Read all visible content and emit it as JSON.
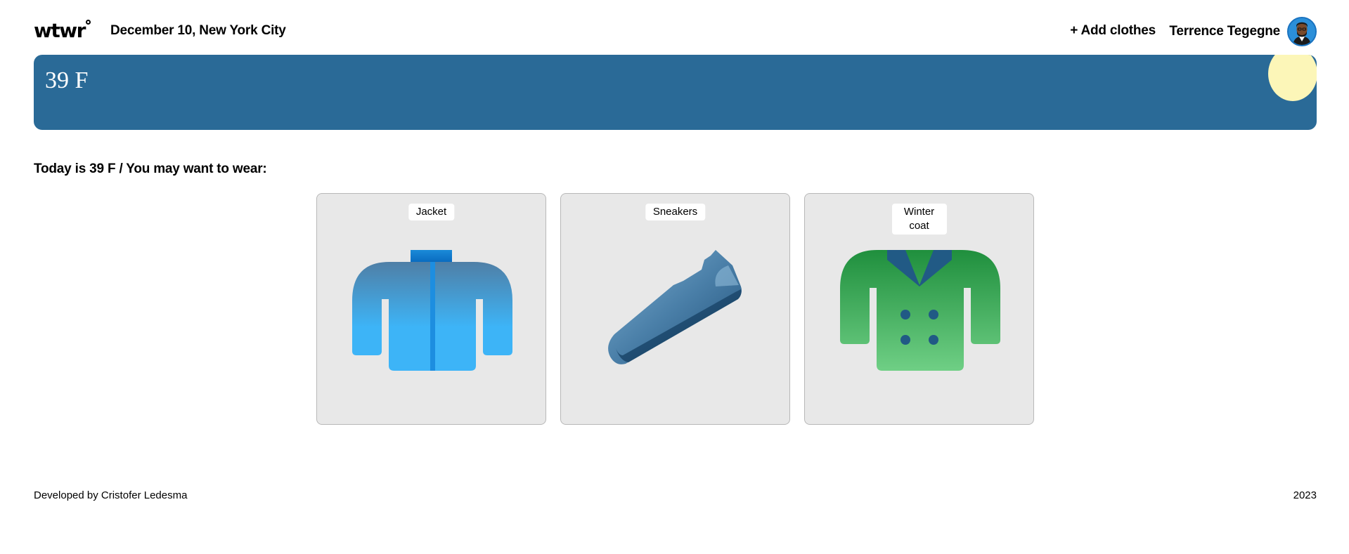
{
  "header": {
    "logo": "wtwr",
    "date_location": "December 10, New York City",
    "add_clothes_label": "+ Add clothes",
    "username": "Terrence Tegegne"
  },
  "weather": {
    "temperature": "39 F",
    "condition_icon": "sun-icon"
  },
  "main": {
    "recommendation": "Today is 39 F / You may want to wear:",
    "items": [
      {
        "name": "Jacket",
        "icon": "jacket-icon",
        "color": "#3db4f7"
      },
      {
        "name": "Sneakers",
        "icon": "sneaker-icon",
        "color": "#3d6e94"
      },
      {
        "name": "Winter coat",
        "icon": "winter-coat-icon",
        "color": "#2a9a45"
      }
    ]
  },
  "footer": {
    "credit": "Developed by Cristofer Ledesma",
    "year": "2023"
  },
  "colors": {
    "weather_bg": "#2a6a97",
    "sun": "#fcf6b8",
    "card_bg": "#e8e8e8"
  }
}
